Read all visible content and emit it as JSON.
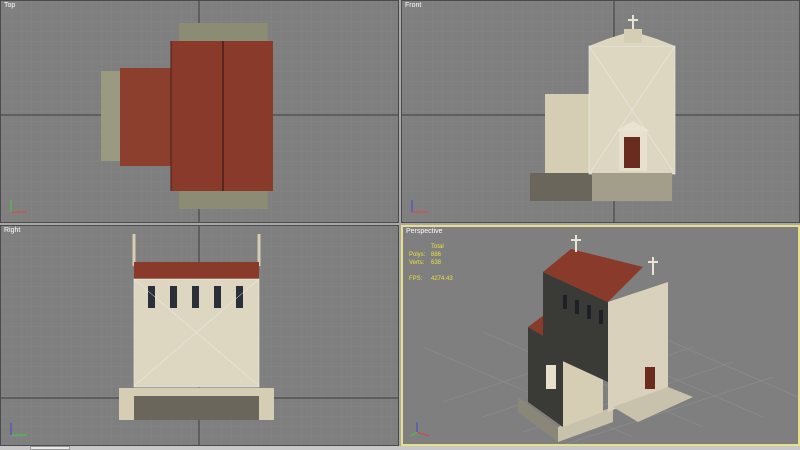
{
  "viewports": {
    "top": {
      "label": "Top"
    },
    "front": {
      "label": "Front"
    },
    "right": {
      "label": "Right"
    },
    "perspective": {
      "label": "Perspective",
      "stats": {
        "header": "Total",
        "polys_label": "Polys:",
        "polys_value": "886",
        "verts_label": "Verts:",
        "verts_value": "638",
        "fps_label": "FPS:",
        "fps_value": "4274.43"
      }
    }
  },
  "colors": {
    "viewport_bg": "#7f7f7f",
    "grid_line": "#8a8a8a",
    "grid_axis": "#3c3c3c",
    "active_border": "#e6e08a",
    "stats_text": "#e8e23c",
    "roof": "#8a3b2c",
    "wall": "#d8d0bb",
    "stone": "#6b665c"
  }
}
